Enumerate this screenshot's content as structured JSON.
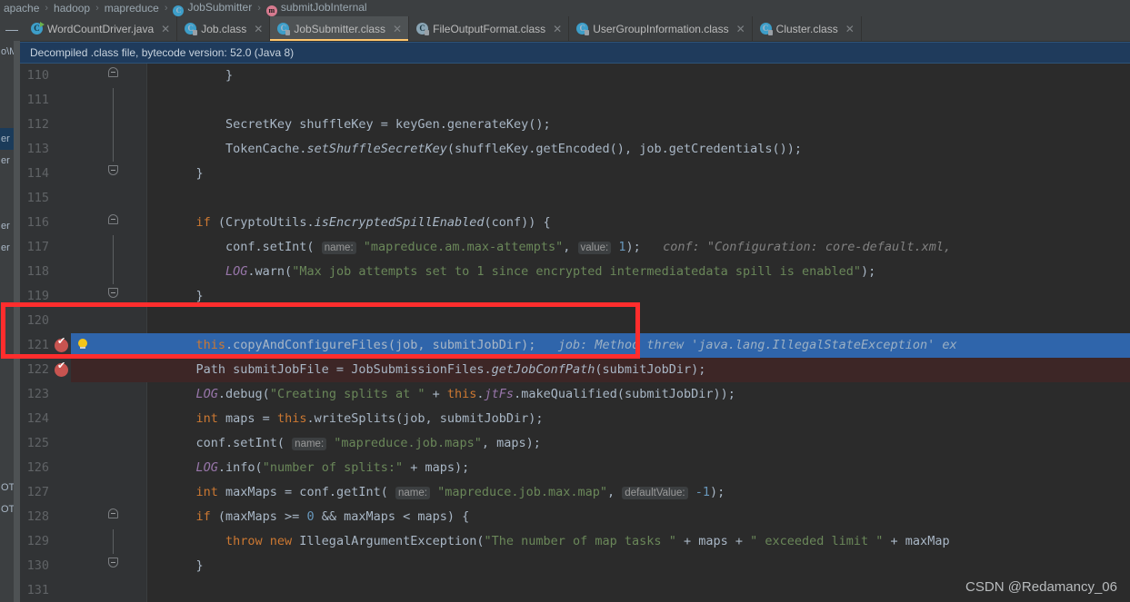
{
  "breadcrumb": {
    "items": [
      {
        "label": "apache",
        "icon": "none"
      },
      {
        "label": "hadoop",
        "icon": "none"
      },
      {
        "label": "mapreduce",
        "icon": "none"
      },
      {
        "label": "JobSubmitter",
        "icon": "class-icon"
      },
      {
        "label": "submitJobInternal",
        "icon": "method-icon"
      }
    ],
    "separator": "›"
  },
  "tabbar": {
    "collapse_glyph": "—",
    "close_glyph": "✕",
    "tabs": [
      {
        "label": "WordCountDriver.java",
        "icon": "java-file-icon",
        "selected": false,
        "letter": "C"
      },
      {
        "label": "Job.class",
        "icon": "class-file-icon",
        "selected": false,
        "letter": "C"
      },
      {
        "label": "JobSubmitter.class",
        "icon": "class-file-icon",
        "selected": true,
        "letter": "C"
      },
      {
        "label": "FileOutputFormat.class",
        "icon": "class-file-icon-alt",
        "selected": false,
        "letter": "C"
      },
      {
        "label": "UserGroupInformation.class",
        "icon": "class-file-icon",
        "selected": false,
        "letter": "C"
      },
      {
        "label": "Cluster.class",
        "icon": "class-file-icon",
        "selected": false,
        "letter": "C"
      }
    ]
  },
  "banner": {
    "text": "Decompiled .class file, bytecode version: 52.0 (Java 8)"
  },
  "left_panel": {
    "rows": [
      "o\\M",
      "",
      "",
      "",
      "er",
      "er",
      "",
      "",
      "er",
      "er",
      "",
      "",
      "",
      "",
      "",
      "",
      "",
      "",
      "",
      "",
      "OT.",
      "OT."
    ]
  },
  "watermark": {
    "text": "CSDN @Redamancy_06"
  },
  "colors": {
    "editor_bg": "#2b2b2b",
    "gutter_bg": "#313335",
    "selection_blue": "#2f65ab",
    "error_red_bg": "#3d2626",
    "breakpoint_red": "#c75450",
    "annotation_red": "#ff2d2d",
    "banner_blue": "#1f3b5c",
    "keyword_orange": "#cc7832",
    "string_green": "#6a8759",
    "number_blue": "#6897bb",
    "field_purple": "#9876aa",
    "text_grey": "#a9b7c6"
  },
  "code": {
    "lines": [
      {
        "num": "110",
        "fold": "up",
        "vline": false,
        "state": "normal",
        "tokens": [
          {
            "t": "pln",
            "v": "        }"
          }
        ]
      },
      {
        "num": "111",
        "fold": "none",
        "vline": true,
        "state": "normal",
        "tokens": []
      },
      {
        "num": "112",
        "fold": "none",
        "vline": true,
        "state": "normal",
        "tokens": [
          {
            "t": "cls",
            "v": "        SecretKey shuffleKey = keyGen."
          },
          {
            "t": "pln",
            "v": "generateKey();"
          }
        ]
      },
      {
        "num": "113",
        "fold": "none",
        "vline": true,
        "state": "normal",
        "tokens": [
          {
            "t": "pln",
            "v": "        TokenCache."
          },
          {
            "t": "mi",
            "v": "setShuffleSecretKey"
          },
          {
            "t": "pln",
            "v": "(shuffleKey.getEncoded(), job.getCredentials());"
          }
        ]
      },
      {
        "num": "114",
        "fold": "down",
        "vline": false,
        "state": "normal",
        "tokens": [
          {
            "t": "pln",
            "v": "    }"
          }
        ]
      },
      {
        "num": "115",
        "fold": "none",
        "vline": false,
        "state": "normal",
        "tokens": []
      },
      {
        "num": "116",
        "fold": "up",
        "vline": false,
        "state": "normal",
        "tokens": [
          {
            "t": "kw",
            "v": "    if"
          },
          {
            "t": "pln",
            "v": " (CryptoUtils."
          },
          {
            "t": "mi",
            "v": "isEncryptedSpillEnabled"
          },
          {
            "t": "pln",
            "v": "(conf)) {"
          }
        ]
      },
      {
        "num": "117",
        "fold": "none",
        "vline": true,
        "state": "normal",
        "tokens": [
          {
            "t": "pln",
            "v": "        conf.setInt( "
          },
          {
            "t": "hint",
            "v": "name:"
          },
          {
            "t": "str",
            "v": " \"mapreduce.am.max-attempts\""
          },
          {
            "t": "pln",
            "v": ", "
          },
          {
            "t": "hint",
            "v": "value:"
          },
          {
            "t": "num",
            "v": " 1"
          },
          {
            "t": "pln",
            "v": ");"
          },
          {
            "t": "cmt",
            "v": "   conf: \"Configuration: core-default.xml,"
          }
        ]
      },
      {
        "num": "118",
        "fold": "none",
        "vline": true,
        "state": "normal",
        "tokens": [
          {
            "t": "fld",
            "v": "        LOG"
          },
          {
            "t": "pln",
            "v": ".warn("
          },
          {
            "t": "str",
            "v": "\"Max job attempts set to 1 since encrypted intermediatedata spill is enabled\""
          },
          {
            "t": "pln",
            "v": ");"
          }
        ]
      },
      {
        "num": "119",
        "fold": "down",
        "vline": false,
        "state": "normal",
        "tokens": [
          {
            "t": "pln",
            "v": "    }"
          }
        ]
      },
      {
        "num": "120",
        "fold": "none",
        "vline": false,
        "state": "normal",
        "tokens": []
      },
      {
        "num": "121",
        "fold": "none",
        "vline": false,
        "state": "selected",
        "breakpoint": true,
        "bulb": true,
        "tokens": [
          {
            "t": "kw",
            "v": "    this"
          },
          {
            "t": "pln",
            "v": ".copyAndConfigureFiles(job, submitJobDir);"
          },
          {
            "t": "ghost",
            "v": "   job: Method threw 'java.lang.IllegalStateException' ex"
          }
        ]
      },
      {
        "num": "122",
        "fold": "none",
        "vline": false,
        "state": "error",
        "breakpoint": true,
        "tokens": [
          {
            "t": "pln",
            "v": "    Path submitJobFile = JobSubmissionFiles."
          },
          {
            "t": "mi",
            "v": "getJobConfPath"
          },
          {
            "t": "pln",
            "v": "(submitJobDir);"
          }
        ]
      },
      {
        "num": "123",
        "fold": "none",
        "vline": false,
        "state": "normal",
        "tokens": [
          {
            "t": "fld",
            "v": "    LOG"
          },
          {
            "t": "pln",
            "v": ".debug("
          },
          {
            "t": "str",
            "v": "\"Creating splits at \""
          },
          {
            "t": "pln",
            "v": " + "
          },
          {
            "t": "kw",
            "v": "this"
          },
          {
            "t": "pln",
            "v": "."
          },
          {
            "t": "fld",
            "v": "jtFs"
          },
          {
            "t": "pln",
            "v": ".makeQualified(submitJobDir));"
          }
        ]
      },
      {
        "num": "124",
        "fold": "none",
        "vline": false,
        "state": "normal",
        "tokens": [
          {
            "t": "kw",
            "v": "    int"
          },
          {
            "t": "pln",
            "v": " maps = "
          },
          {
            "t": "kw",
            "v": "this"
          },
          {
            "t": "pln",
            "v": ".writeSplits(job, submitJobDir);"
          }
        ]
      },
      {
        "num": "125",
        "fold": "none",
        "vline": false,
        "state": "normal",
        "tokens": [
          {
            "t": "pln",
            "v": "    conf.setInt( "
          },
          {
            "t": "hint",
            "v": "name:"
          },
          {
            "t": "str",
            "v": " \"mapreduce.job.maps\""
          },
          {
            "t": "pln",
            "v": ", maps);"
          }
        ]
      },
      {
        "num": "126",
        "fold": "none",
        "vline": false,
        "state": "normal",
        "tokens": [
          {
            "t": "fld",
            "v": "    LOG"
          },
          {
            "t": "pln",
            "v": ".info("
          },
          {
            "t": "str",
            "v": "\"number of splits:\""
          },
          {
            "t": "pln",
            "v": " + maps);"
          }
        ]
      },
      {
        "num": "127",
        "fold": "none",
        "vline": false,
        "state": "normal",
        "tokens": [
          {
            "t": "kw",
            "v": "    int"
          },
          {
            "t": "pln",
            "v": " maxMaps = conf.getInt( "
          },
          {
            "t": "hint",
            "v": "name:"
          },
          {
            "t": "str",
            "v": " \"mapreduce.job.max.map\""
          },
          {
            "t": "pln",
            "v": ", "
          },
          {
            "t": "hint",
            "v": "defaultValue:"
          },
          {
            "t": "num",
            "v": " -1"
          },
          {
            "t": "pln",
            "v": ");"
          }
        ]
      },
      {
        "num": "128",
        "fold": "up",
        "vline": false,
        "state": "normal",
        "tokens": [
          {
            "t": "kw",
            "v": "    if"
          },
          {
            "t": "pln",
            "v": " (maxMaps >= "
          },
          {
            "t": "num",
            "v": "0"
          },
          {
            "t": "pln",
            "v": " && maxMaps < maps) {"
          }
        ]
      },
      {
        "num": "129",
        "fold": "none",
        "vline": true,
        "state": "normal",
        "tokens": [
          {
            "t": "kw",
            "v": "        throw new"
          },
          {
            "t": "pln",
            "v": " IllegalArgumentException("
          },
          {
            "t": "str",
            "v": "\"The number of map tasks \""
          },
          {
            "t": "pln",
            "v": " + maps + "
          },
          {
            "t": "str",
            "v": "\" exceeded limit \""
          },
          {
            "t": "pln",
            "v": " + maxMap"
          }
        ]
      },
      {
        "num": "130",
        "fold": "down",
        "vline": false,
        "state": "normal",
        "tokens": [
          {
            "t": "pln",
            "v": "    }"
          }
        ]
      },
      {
        "num": "131",
        "fold": "none",
        "vline": false,
        "state": "normal",
        "tokens": []
      }
    ]
  }
}
